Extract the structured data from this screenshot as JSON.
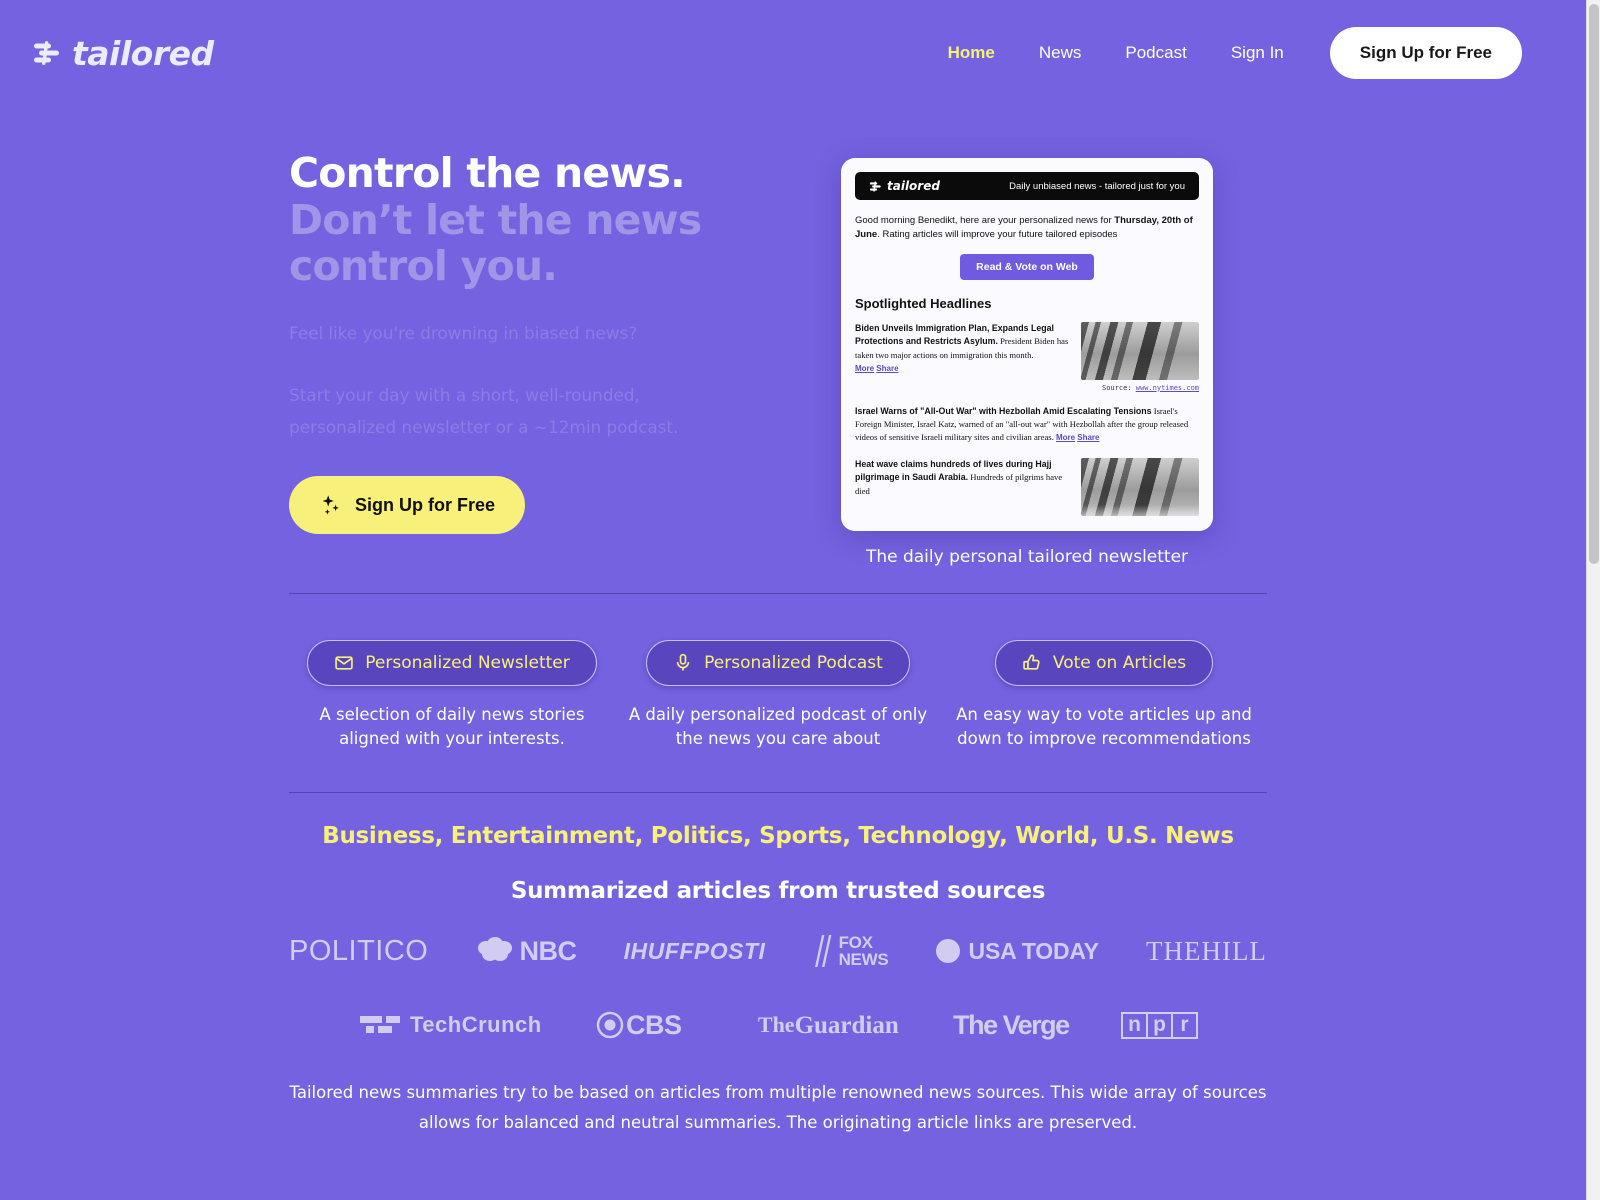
{
  "brand": {
    "name": "tailored"
  },
  "nav": {
    "links": [
      {
        "label": "Home",
        "active": true
      },
      {
        "label": "News",
        "active": false
      },
      {
        "label": "Podcast",
        "active": false
      },
      {
        "label": "Sign In",
        "active": false
      }
    ],
    "signup_label": "Sign Up for Free"
  },
  "hero": {
    "headline_line1": "Control the news.",
    "headline_line2": "Don’t let the news",
    "headline_line3": "control you.",
    "sub1": "Feel like you're drowning in biased news?",
    "sub2": "Start your day with a short, well-rounded, personalized newsletter or a ~12min podcast.",
    "cta_label": "Sign Up for Free",
    "cta_icon": "sparkles-icon"
  },
  "preview": {
    "bar_brand": "tailored",
    "bar_tagline": "Daily unbiased news - tailored just for you",
    "greeting_prefix": "Good morning Benedikt, here are your personalized news for ",
    "greeting_date": "Thursday, 20th of June",
    "greeting_suffix": ". Rating articles will improve your future tailored episodes",
    "read_button": "Read & Vote on Web",
    "section_title": "Spotlighted Headlines",
    "articles": [
      {
        "headline": "Biden Unveils Immigration Plan, Expands Legal Protections and Restricts Asylum.",
        "body": " President Biden has taken two major actions on immigration this month. ",
        "more": "More",
        "share": "Share",
        "source_label": "Source:",
        "source_url": "www.nytimes.com",
        "has_thumb": true
      },
      {
        "headline": "Israel Warns of \"All-Out War\" with Hezbollah Amid Escalating Tensions",
        "body": " Israel's Foreign Minister, Israel Katz, warned of an \"all-out war\" with Hezbollah after the group released videos of sensitive Israeli military sites and civilian areas. ",
        "more": "More",
        "share": "Share",
        "has_thumb": false
      },
      {
        "headline": "Heat wave claims hundreds of lives during Hajj pilgrimage in Saudi Arabia.",
        "body": " Hundreds of pilgrims have died",
        "has_thumb": true
      }
    ],
    "caption": "The daily personal tailored newsletter"
  },
  "features": [
    {
      "icon": "envelope-icon",
      "label": "Personalized Newsletter",
      "desc": "A selection of daily news stories aligned with your interests."
    },
    {
      "icon": "microphone-icon",
      "label": "Personalized Podcast",
      "desc": "A daily personalized podcast of only the news you care about"
    },
    {
      "icon": "thumbs-up-icon",
      "label": "Vote on Articles",
      "desc": "An easy way to vote articles up and down to improve recommendations"
    }
  ],
  "sources": {
    "categories": "Business, Entertainment, Politics, Sports, Technology, World, U.S. News",
    "subtitle": "Summarized articles from trusted sources",
    "row1": [
      {
        "id": "politico",
        "text": "POLITICO"
      },
      {
        "id": "nbc",
        "text": "NBC"
      },
      {
        "id": "huffpost",
        "text": "IHUFFPOSTI"
      },
      {
        "id": "foxnews",
        "text": "FOX",
        "text2": "NEWS"
      },
      {
        "id": "usatoday",
        "text": "USA TODAY"
      },
      {
        "id": "thehill",
        "text": "THE",
        "text2": "HILL"
      }
    ],
    "row2": [
      {
        "id": "techcrunch",
        "text": "TechCrunch"
      },
      {
        "id": "cbs",
        "text": "CBS"
      },
      {
        "id": "guardian",
        "text": "The",
        "text2": "Guardian"
      },
      {
        "id": "theverge",
        "text": "The Verge"
      },
      {
        "id": "npr",
        "text": "n",
        "text2": "p",
        "text3": "r"
      }
    ],
    "note": "Tailored news summaries try to be based on articles from multiple renowned news sources. This wide array of sources allows for balanced and neutral summaries. The originating article links are preserved."
  },
  "colors": {
    "background": "#7462E0",
    "accent_yellow": "#F7F07A",
    "muted_heading": "#A096E8",
    "pill_fill": "#5946BE"
  }
}
